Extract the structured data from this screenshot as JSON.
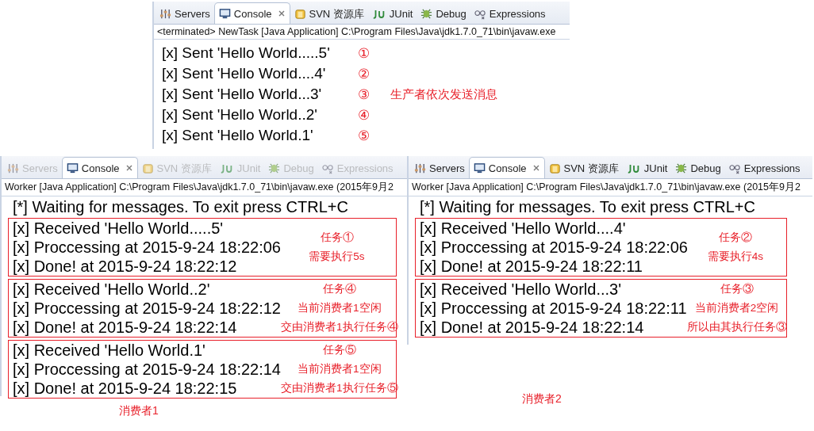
{
  "producer": {
    "tabs_dimmed": false,
    "tabs": [
      {
        "label": "Servers",
        "kind": "servers",
        "selected": false
      },
      {
        "label": "Console",
        "kind": "console",
        "selected": true
      },
      {
        "label": "SVN 资源库",
        "kind": "svn",
        "selected": false
      },
      {
        "label": "JUnit",
        "kind": "junit",
        "selected": false
      },
      {
        "label": "Debug",
        "kind": "debug",
        "selected": false
      },
      {
        "label": "Expressions",
        "kind": "expressions",
        "selected": false
      }
    ],
    "status": "<terminated> NewTask [Java Application] C:\\Program Files\\Java\\jdk1.7.0_71\\bin\\javaw.exe",
    "lines": [
      {
        "text": "[x] Sent 'Hello World.....5'",
        "mark": "①"
      },
      {
        "text": "[x] Sent 'Hello World....4'",
        "mark": "②"
      },
      {
        "text": "[x] Sent 'Hello World...3'",
        "mark": "③"
      },
      {
        "text": "[x] Sent 'Hello World..2'",
        "mark": "④"
      },
      {
        "text": "[x] Sent 'Hello World.1'",
        "mark": "⑤"
      }
    ],
    "annotation": "生产者依次发送消息"
  },
  "consumers": [
    {
      "tabs_dimmed": true,
      "tabs": [
        {
          "label": "Servers",
          "kind": "servers",
          "selected": false
        },
        {
          "label": "Console",
          "kind": "console",
          "selected": true
        },
        {
          "label": "SVN 资源库",
          "kind": "svn",
          "selected": false
        },
        {
          "label": "JUnit",
          "kind": "junit",
          "selected": false
        },
        {
          "label": "Debug",
          "kind": "debug",
          "selected": false
        },
        {
          "label": "Expressions",
          "kind": "expressions",
          "selected": false
        }
      ],
      "status": "Worker [Java Application] C:\\Program Files\\Java\\jdk1.7.0_71\\bin\\javaw.exe (2015年9月2",
      "header": "[*] Waiting for messages. To exit press CTRL+C",
      "groups": [
        {
          "lines": [
            "[x] Received 'Hello World.....5'",
            "[x] Proccessing at 2015-9-24 18:22:06",
            "[x] Done! at 2015-9-24 18:22:12"
          ],
          "notes": [
            "任务①",
            "需要执行5s"
          ]
        },
        {
          "lines": [
            "[x] Received 'Hello World..2'",
            "[x] Proccessing at 2015-9-24 18:22:12",
            "[x] Done! at 2015-9-24 18:22:14"
          ],
          "notes": [
            "任务④",
            "当前消费者1空闲",
            "交由消费者1执行任务④"
          ]
        },
        {
          "lines": [
            "[x] Received 'Hello World.1'",
            "[x] Proccessing at 2015-9-24 18:22:14",
            "[x] Done! at 2015-9-24 18:22:15"
          ],
          "notes": [
            "任务⑤",
            "当前消费者1空闲",
            "交由消费者1执行任务⑤"
          ]
        }
      ],
      "caption": "消费者1"
    },
    {
      "tabs_dimmed": false,
      "tabs": [
        {
          "label": "Servers",
          "kind": "servers",
          "selected": false
        },
        {
          "label": "Console",
          "kind": "console",
          "selected": true
        },
        {
          "label": "SVN 资源库",
          "kind": "svn",
          "selected": false
        },
        {
          "label": "JUnit",
          "kind": "junit",
          "selected": false
        },
        {
          "label": "Debug",
          "kind": "debug",
          "selected": false
        },
        {
          "label": "Expressions",
          "kind": "expressions",
          "selected": false
        }
      ],
      "status": "Worker [Java Application] C:\\Program Files\\Java\\jdk1.7.0_71\\bin\\javaw.exe (2015年9月2",
      "header": "[*] Waiting for messages. To exit press CTRL+C",
      "groups": [
        {
          "lines": [
            "[x] Received 'Hello World....4'",
            "[x] Proccessing at 2015-9-24 18:22:06",
            "[x] Done! at 2015-9-24 18:22:11"
          ],
          "notes": [
            "任务②",
            "需要执行4s"
          ]
        },
        {
          "lines": [
            "[x] Received 'Hello World...3'",
            "[x] Proccessing at 2015-9-24 18:22:11",
            "[x] Done! at 2015-9-24 18:22:14"
          ],
          "notes": [
            "任务③",
            "当前消费者2空闲",
            "所以由其执行任务③"
          ]
        }
      ],
      "caption": "消费者2"
    }
  ]
}
